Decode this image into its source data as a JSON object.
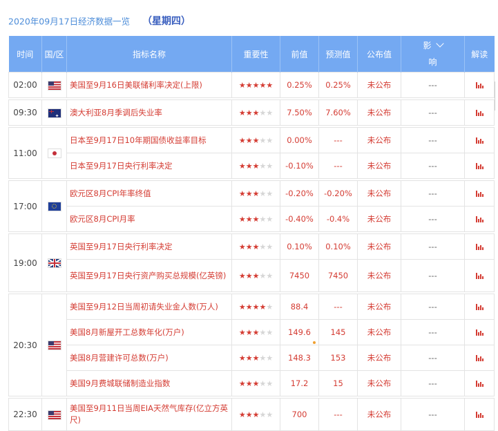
{
  "header": {
    "date_title": "2020年09月17日经济数据一览",
    "weekday": "（星期四）"
  },
  "columns": {
    "time": "时间",
    "region": "国/区",
    "indicator": "指标名称",
    "importance": "重要性",
    "previous": "前值",
    "forecast": "预测值",
    "announced": "公布值",
    "impact_top": "影",
    "impact_bottom": "响",
    "analysis": "解读"
  },
  "colors": {
    "header_bg": "#74a9f2",
    "text_red": "#d43c33",
    "title_blue": "#4d8dd9"
  },
  "groups": [
    {
      "time": "02:00",
      "flag": "us",
      "rows": [
        {
          "name": "美国至9月16日美联储利率决定(上限)",
          "stars": 5,
          "previous": "0.25%",
          "forecast": "0.25%",
          "announced": "未公布",
          "impact": "---"
        }
      ]
    },
    {
      "time": "09:30",
      "flag": "au",
      "rows": [
        {
          "name": "澳大利亚8月季调后失业率",
          "stars": 3,
          "previous": "7.50%",
          "forecast": "7.60%",
          "announced": "未公布",
          "impact": "---"
        }
      ]
    },
    {
      "time": "11:00",
      "flag": "jp",
      "rows": [
        {
          "name": "日本至9月17日10年期国债收益率目标",
          "stars": 3,
          "previous": "0.00%",
          "forecast": "---",
          "announced": "未公布",
          "impact": "---"
        },
        {
          "name": "日本至9月17日央行利率决定",
          "stars": 3,
          "previous": "-0.10%",
          "forecast": "---",
          "announced": "未公布",
          "impact": "---"
        }
      ]
    },
    {
      "time": "17:00",
      "flag": "eu",
      "rows": [
        {
          "name": "欧元区8月CPI年率终值",
          "stars": 3,
          "previous": "-0.20%",
          "forecast": "-0.20%",
          "announced": "未公布",
          "impact": "---"
        },
        {
          "name": "欧元区8月CPI月率",
          "stars": 3,
          "previous": "-0.40%",
          "forecast": "-0.4%",
          "announced": "未公布",
          "impact": "---"
        }
      ]
    },
    {
      "time": "19:00",
      "flag": "uk",
      "rows": [
        {
          "name": "英国至9月17日央行利率决定",
          "stars": 3,
          "previous": "0.10%",
          "forecast": "0.10%",
          "announced": "未公布",
          "impact": "---"
        },
        {
          "name": "英国至9月17日央行资产购买总规模(亿英镑)",
          "stars": 3,
          "previous": "7450",
          "forecast": "7450",
          "announced": "未公布",
          "impact": "---",
          "tall": true
        }
      ]
    },
    {
      "time": "20:30",
      "flag": "us",
      "rows": [
        {
          "name": "美国至9月12日当周初请失业金人数(万人)",
          "stars": 4,
          "previous": "88.4",
          "forecast": "---",
          "announced": "未公布",
          "impact": "---"
        },
        {
          "name": "美国8月新屋开工总数年化(万户)",
          "stars": 3,
          "previous": "149.6",
          "forecast": "145",
          "announced": "未公布",
          "impact": "---"
        },
        {
          "name": "美国8月营建许可总数(万户)",
          "stars": 3,
          "previous": "148.3",
          "forecast": "153",
          "announced": "未公布",
          "impact": "---"
        },
        {
          "name": "美国9月费城联储制造业指数",
          "stars": 3,
          "previous": "17.2",
          "forecast": "15",
          "announced": "未公布",
          "impact": "---"
        }
      ]
    },
    {
      "time": "22:30",
      "flag": "us",
      "rows": [
        {
          "name": "美国至9月11日当周EIA天然气库存(亿立方英尺)",
          "stars": 3,
          "previous": "700",
          "forecast": "---",
          "announced": "未公布",
          "impact": "---",
          "tall": true
        }
      ]
    }
  ]
}
